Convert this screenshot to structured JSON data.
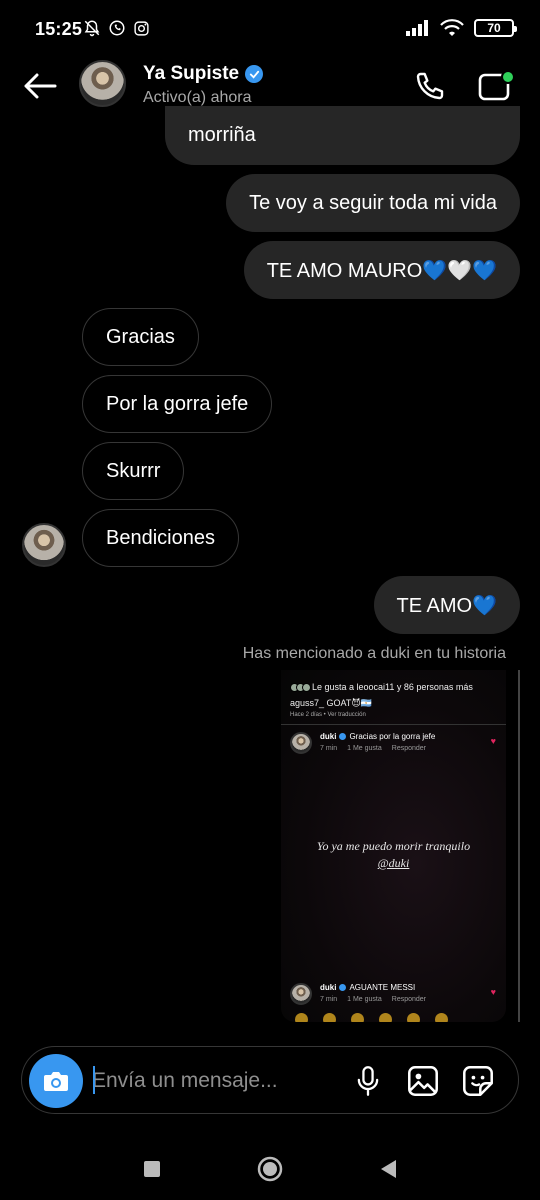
{
  "status_bar": {
    "time": "15:25",
    "battery": "70",
    "icons_left": [
      "mute-bell-icon",
      "whatsapp-icon",
      "instagram-icon"
    ],
    "icons_right": [
      "signal-icon",
      "wifi-icon",
      "battery-icon"
    ]
  },
  "header": {
    "name": "Ya Supiste",
    "verified": true,
    "status": "Activo(a) ahora",
    "accent": "#3897f0",
    "online_dot": "#2fd05a"
  },
  "messages": [
    {
      "direction": "out",
      "text": "morriña"
    },
    {
      "direction": "out",
      "text": "Te voy a seguir toda mi vida"
    },
    {
      "direction": "out",
      "text": "TE AMO MAURO💙🤍💙"
    },
    {
      "direction": "in",
      "text": "Gracias"
    },
    {
      "direction": "in",
      "text": "Por la gorra jefe"
    },
    {
      "direction": "in",
      "text": "Skurrr"
    },
    {
      "direction": "in",
      "text": "Bendiciones"
    },
    {
      "direction": "out",
      "text": "TE AMO💙"
    }
  ],
  "mention_note": "Has mencionado a duki en tu historia",
  "shared_story": {
    "likes_text": "Le gusta a leoocai11 y 86 personas más",
    "caption": "aguss7_ GOAT😈🇦🇷",
    "meta": "Hace 2 días • Ver traducción",
    "comments": [
      {
        "user": "duki",
        "text": "Gracias por la gorra jefe",
        "time": "7 min",
        "likes": "1 Me gusta",
        "reply": "Responder"
      },
      {
        "user": "duki",
        "text": "AGUANTE MESSI",
        "time": "7 min",
        "likes": "1 Me gusta",
        "reply": "Responder"
      }
    ],
    "center_text": "Yo ya me puedo morir tranquilo",
    "center_mention": "@duki"
  },
  "composer": {
    "placeholder": "Envía un mensaje..."
  }
}
